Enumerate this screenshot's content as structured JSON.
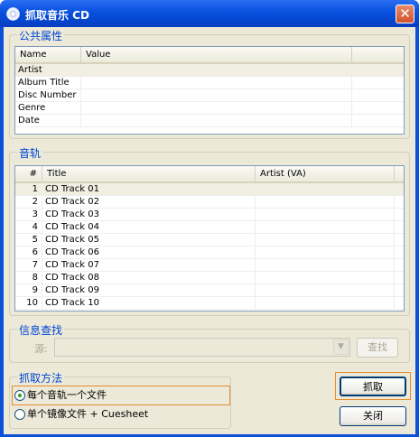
{
  "window": {
    "title": "抓取音乐 CD",
    "close_glyph": "✕"
  },
  "common_props": {
    "label": "公共属性",
    "columns": [
      "Name",
      "Value"
    ],
    "rows": [
      {
        "name": "Artist",
        "value": ""
      },
      {
        "name": "Album Title",
        "value": ""
      },
      {
        "name": "Disc Number",
        "value": ""
      },
      {
        "name": "Genre",
        "value": ""
      },
      {
        "name": "Date",
        "value": ""
      }
    ]
  },
  "tracks": {
    "label": "音轨",
    "columns": [
      "#",
      "Title",
      "Artist (VA)"
    ],
    "rows": [
      {
        "num": "1",
        "title": "CD Track 01",
        "artist": ""
      },
      {
        "num": "2",
        "title": "CD Track 02",
        "artist": ""
      },
      {
        "num": "3",
        "title": "CD Track 03",
        "artist": ""
      },
      {
        "num": "4",
        "title": "CD Track 04",
        "artist": ""
      },
      {
        "num": "5",
        "title": "CD Track 05",
        "artist": ""
      },
      {
        "num": "6",
        "title": "CD Track 06",
        "artist": ""
      },
      {
        "num": "7",
        "title": "CD Track 07",
        "artist": ""
      },
      {
        "num": "8",
        "title": "CD Track 08",
        "artist": ""
      },
      {
        "num": "9",
        "title": "CD Track 09",
        "artist": ""
      },
      {
        "num": "10",
        "title": "CD Track 10",
        "artist": ""
      }
    ]
  },
  "lookup": {
    "label": "信息查找",
    "source_label": "源:",
    "source_value": "",
    "search_button": "查找"
  },
  "rip_method": {
    "label": "抓取方法",
    "options": [
      "每个音轨一个文件",
      "单个镜像文件 + Cuesheet"
    ],
    "selected_index": 0
  },
  "actions": {
    "rip_button": "抓取",
    "close_button": "关闭"
  },
  "icons": {
    "title_icon": "cd-icon",
    "close_icon": "close-icon",
    "dropdown_icon": "chevron-down-icon"
  },
  "colors": {
    "group_label": "#0046d5",
    "title_bar": "#0a53e0",
    "focus": "#e68b2c"
  }
}
